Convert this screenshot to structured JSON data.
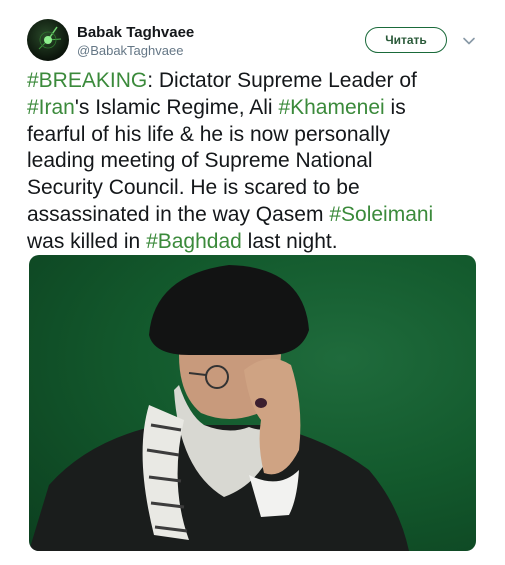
{
  "user": {
    "display_name": "Babak Taghvaee",
    "handle": "@BabakTaghvaee",
    "avatar_icon": "avatar-icon"
  },
  "follow_button": {
    "label": "Читать"
  },
  "menu": {
    "icon": "chevron-down-icon"
  },
  "tweet": {
    "lines": [
      [
        {
          "text": "#BREAKING",
          "hashtag": true
        },
        {
          "text": ": Dictator Supreme Leader of",
          "hashtag": false
        }
      ],
      [
        {
          "text": "#Iran",
          "hashtag": true
        },
        {
          "text": "'s Islamic Regime, Ali ",
          "hashtag": false
        },
        {
          "text": "#Khamenei",
          "hashtag": true
        },
        {
          "text": " is",
          "hashtag": false
        }
      ],
      [
        {
          "text": "fearful of his life & he is now personally",
          "hashtag": false
        }
      ],
      [
        {
          "text": "leading meeting of Supreme National",
          "hashtag": false
        }
      ],
      [
        {
          "text": "Security Council. He is scared to be",
          "hashtag": false
        }
      ],
      [
        {
          "text": "assassinated in the way Qasem ",
          "hashtag": false
        },
        {
          "text": "#Soleimani",
          "hashtag": true
        }
      ],
      [
        {
          "text": " was killed in ",
          "hashtag": false
        },
        {
          "text": "#Baghdad",
          "hashtag": true
        },
        {
          "text": " last night.",
          "hashtag": false
        }
      ]
    ]
  },
  "colors": {
    "hashtag": "#3b8a3b",
    "text": "#14171a",
    "secondary": "#657786",
    "media_background": "#135a2d"
  }
}
